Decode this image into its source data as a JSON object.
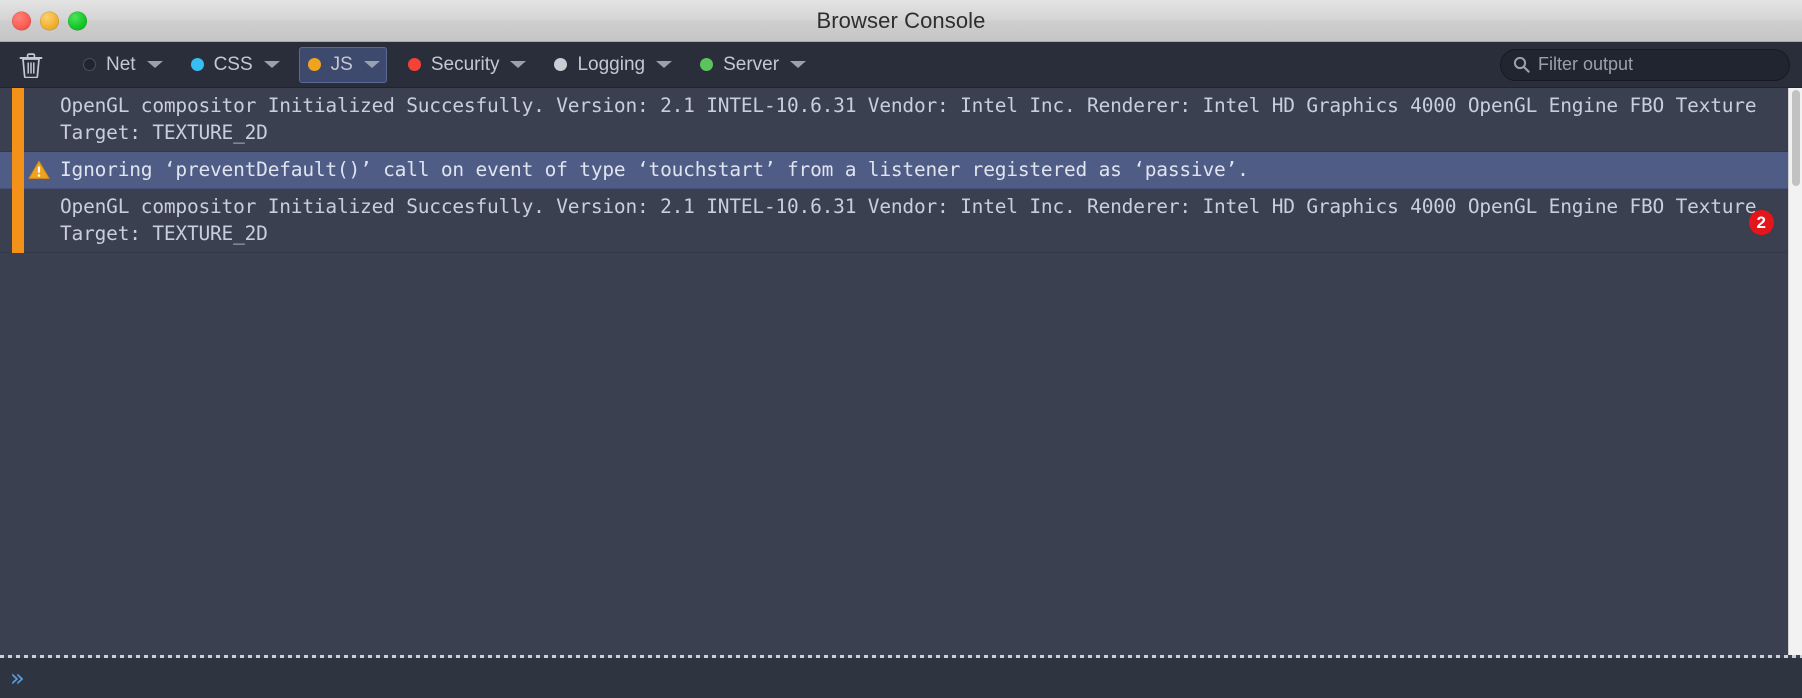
{
  "window": {
    "title": "Browser Console",
    "traffic_lights": [
      {
        "name": "close",
        "color": "#fc5f57"
      },
      {
        "name": "minimize",
        "color": "#f0b235"
      },
      {
        "name": "maximize",
        "color": "#17c72b"
      }
    ]
  },
  "toolbar": {
    "clear_button_label": "Clear output",
    "filters": [
      {
        "label": "Net",
        "dot_color": "#20242e",
        "active": false,
        "has_caret": true
      },
      {
        "label": "CSS",
        "dot_color": "#36bdf2",
        "active": false,
        "has_caret": true
      },
      {
        "label": "JS",
        "dot_color": "#f0a31e",
        "active": true,
        "has_caret": true
      },
      {
        "label": "Security",
        "dot_color": "#f44336",
        "active": false,
        "has_caret": true
      },
      {
        "label": "Logging",
        "dot_color": "#c9cdd4",
        "active": false,
        "has_caret": true
      },
      {
        "label": "Server",
        "dot_color": "#5cc45c",
        "active": false,
        "has_caret": true
      }
    ],
    "search": {
      "placeholder": "Filter output",
      "value": ""
    }
  },
  "console": {
    "rows": [
      {
        "severity": "log",
        "icon": "",
        "text": "OpenGL compositor Initialized Succesfully. Version: 2.1 INTEL-10.6.31 Vendor: Intel Inc. Renderer: Intel HD Graphics 4000 OpenGL Engine FBO Texture Target: TEXTURE_2D",
        "count": ""
      },
      {
        "severity": "warn",
        "icon": "warning-triangle-icon",
        "text": "Ignoring ‘preventDefault()’ call on event of type ‘touchstart’ from a listener registered as ‘passive’.",
        "count": ""
      },
      {
        "severity": "log",
        "icon": "",
        "text": "OpenGL compositor Initialized Succesfully. Version: 2.1 INTEL-10.6.31 Vendor: Intel Inc. Renderer: Intel HD Graphics 4000 OpenGL Engine FBO Texture Target: TEXTURE_2D",
        "count": "2"
      }
    ]
  },
  "prompt": {
    "chevrons": "»",
    "value": "",
    "placeholder": ""
  },
  "colors": {
    "warning_stripe": "#f49119",
    "warning_row_bg": "#4f5c86",
    "console_bg": "#3b4050",
    "toolbar_bg": "#2a2e3a",
    "badge_red": "#e5161b",
    "active_filter_bg": "#3e4a6d"
  }
}
